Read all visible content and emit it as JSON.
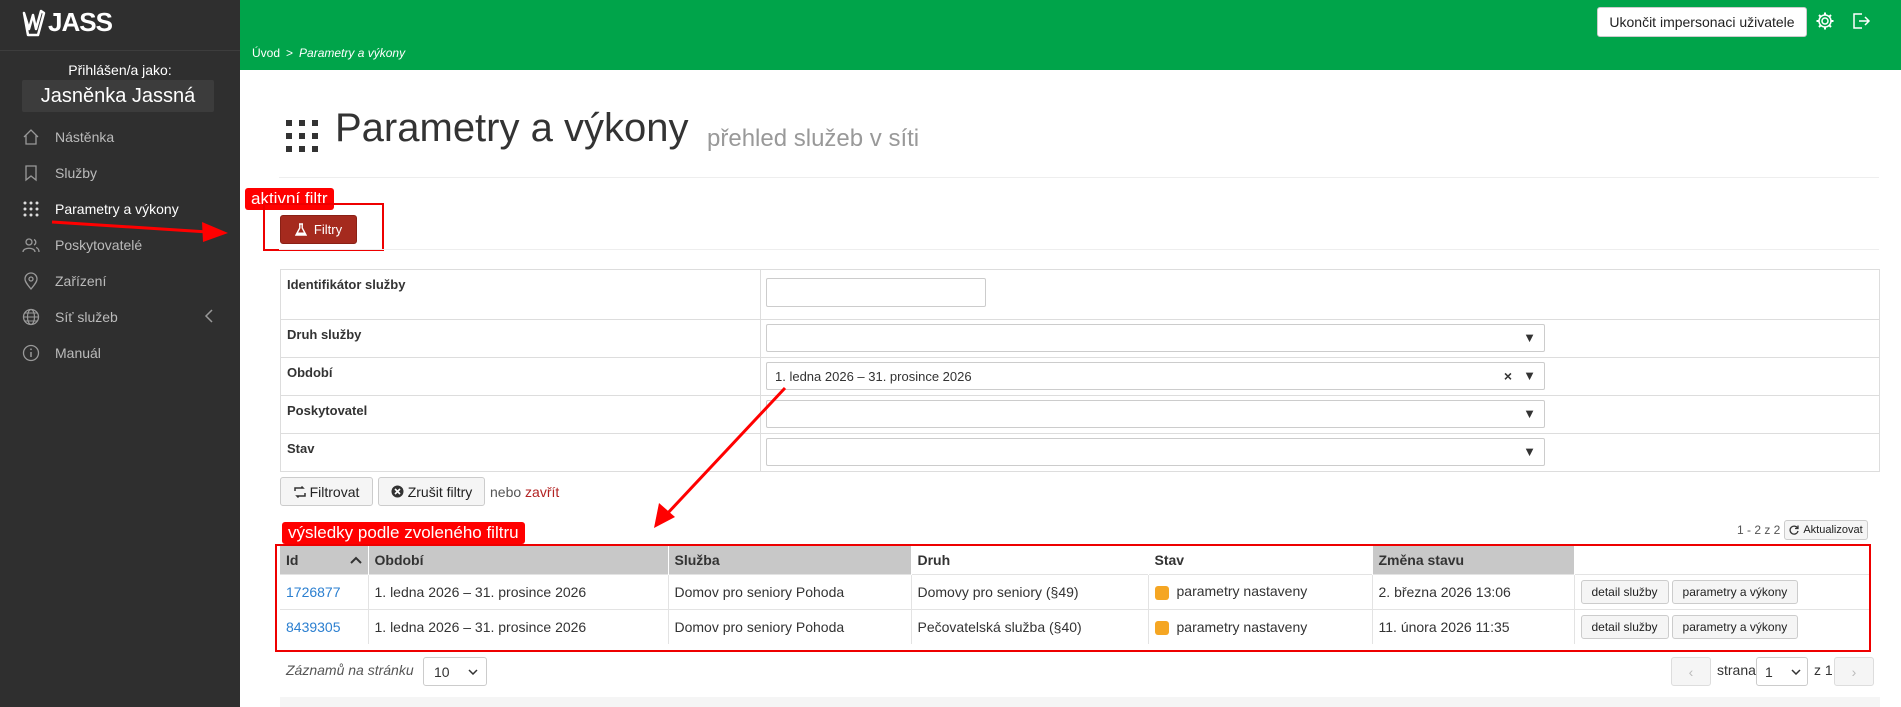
{
  "app": {
    "logo_text": "JASS"
  },
  "sidebar": {
    "login_label": "Přihlášen/a jako:",
    "user_name": "Jasněnka Jassná",
    "items": [
      {
        "label": "Nástěnka",
        "icon": "home-icon"
      },
      {
        "label": "Služby",
        "icon": "bookmark-icon"
      },
      {
        "label": "Parametry a výkony",
        "icon": "grid-dots-icon",
        "active": true
      },
      {
        "label": "Poskytovatelé",
        "icon": "users-icon"
      },
      {
        "label": "Zařízení",
        "icon": "map-pin-icon"
      },
      {
        "label": "Síť služeb",
        "icon": "globe-icon"
      },
      {
        "label": "Manuál",
        "icon": "info-icon"
      }
    ]
  },
  "header": {
    "impersonate_label": "Ukončit impersonaci uživatele",
    "breadcrumb_home": "Úvod",
    "breadcrumb_sep": ">",
    "breadcrumb_current": "Parametry a výkony"
  },
  "page": {
    "title": "Parametry a výkony",
    "subtitle": "přehled služeb v síti"
  },
  "annotations": {
    "active_filter": "aktivní filtr",
    "results_by_filter": "výsledky podle zvoleného filtru"
  },
  "filters": {
    "toggle_label": "Filtry",
    "fields": [
      {
        "label": "Identifikátor služby",
        "value": ""
      },
      {
        "label": "Druh služby",
        "value": ""
      },
      {
        "label": "Období",
        "value": "1. ledna 2026 – 31. prosince 2026"
      },
      {
        "label": "Poskytovatel",
        "value": ""
      },
      {
        "label": "Stav",
        "value": ""
      }
    ],
    "clear_symbol": "×",
    "arrow_symbol": "▼",
    "filter_button": "Filtrovat",
    "reset_button": "Zrušit filtry",
    "or_text": "nebo",
    "close_link": "zavřít"
  },
  "results": {
    "count_info": "1 - 2 z 2",
    "refresh_label": "Aktualizovat",
    "columns": [
      "Id",
      "Období",
      "Služba",
      "Druh",
      "Stav",
      "Změna stavu"
    ],
    "rows": [
      {
        "id": "1726877",
        "period": "1. ledna 2026 – 31. prosince 2026",
        "service": "Domov pro seniory Pohoda",
        "kind": "Domovy pro seniory (§49)",
        "status": "parametry nastaveny",
        "changed": "2. března 2026 13:06"
      },
      {
        "id": "8439305",
        "period": "1. ledna 2026 – 31. prosince 2026",
        "service": "Domov pro seniory Pohoda",
        "kind": "Pečovatelská služba (§40)",
        "status": "parametry nastaveny",
        "changed": "11. února 2026 11:35"
      }
    ],
    "detail_button": "detail služby",
    "params_button": "parametry a výkony",
    "status_color": "#f5a623"
  },
  "pagination": {
    "per_page_label": "Záznamů na stránku",
    "per_page_value": "10",
    "page_label": "strana",
    "page_value": "1",
    "of_label": "z 1",
    "prev_symbol": "‹",
    "next_symbol": "›"
  },
  "colors": {
    "topbar": "#00a44a",
    "sidebar": "#2f2f2f",
    "annotation": "#ff0000",
    "filter_button": "#a52a1e"
  }
}
